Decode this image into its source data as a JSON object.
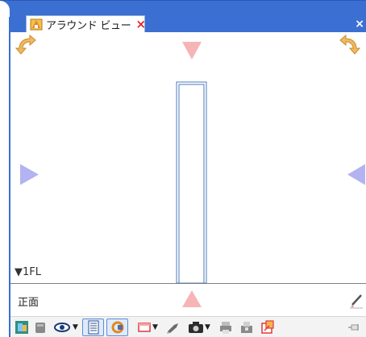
{
  "window": {
    "tab_title": "アラウンド ビュー",
    "tab_close_glyph": "×",
    "frame_close_glyph": "×"
  },
  "view": {
    "level_label": "▼1FL",
    "face_label": "正面"
  },
  "colors": {
    "frame_blue": "#3c6fd2",
    "nav_arrow_pink": "#f6b4b6",
    "nav_arrow_lavender": "#b3b3f2",
    "column_outline": "#4a78c2",
    "rotate_icon_orange": "#f1b862"
  },
  "toolbar": {
    "items": [
      "model-view-icon",
      "layer-icon",
      "visibility-eye-icon",
      "dimension-icon",
      "rotate-lock-icon",
      "display-frame-icon",
      "paint-brush-icon",
      "camera-icon",
      "print-icon",
      "export-icon",
      "settings-icon",
      "pin-icon"
    ]
  }
}
